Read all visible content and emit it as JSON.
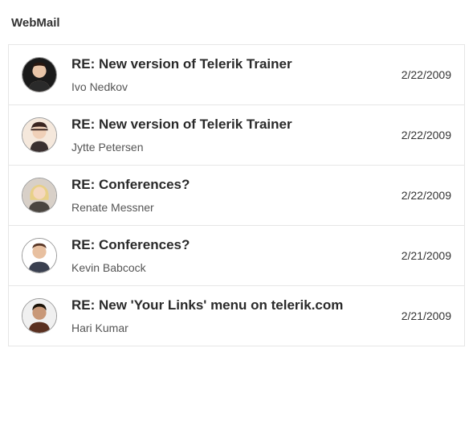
{
  "title": "WebMail",
  "messages": [
    {
      "subject": "RE: New version of Telerik Trainer",
      "sender": "Ivo Nedkov",
      "date": "2/22/2009",
      "avatar_bg": "#1a1a1a",
      "avatar_skin": "#e8c5a8",
      "avatar_hair": "#2a1810"
    },
    {
      "subject": "RE: New version of Telerik Trainer",
      "sender": "Jytte Petersen",
      "date": "2/22/2009",
      "avatar_bg": "#f5e8dc",
      "avatar_skin": "#f0d0b8",
      "avatar_hair": "#3a2520"
    },
    {
      "subject": "RE: Conferences?",
      "sender": "Renate Messner",
      "date": "2/22/2009",
      "avatar_bg": "#d8d0c8",
      "avatar_skin": "#f5d8c0",
      "avatar_hair": "#e8d088"
    },
    {
      "subject": "RE: Conferences?",
      "sender": "Kevin Babcock",
      "date": "2/21/2009",
      "avatar_bg": "#ffffff",
      "avatar_skin": "#e8c0a0",
      "avatar_hair": "#5a3828"
    },
    {
      "subject": "RE: New 'Your Links' menu on telerik.com",
      "sender": "Hari Kumar",
      "date": "2/21/2009",
      "avatar_bg": "#f0f0f0",
      "avatar_skin": "#c89878",
      "avatar_hair": "#1a1208"
    }
  ]
}
